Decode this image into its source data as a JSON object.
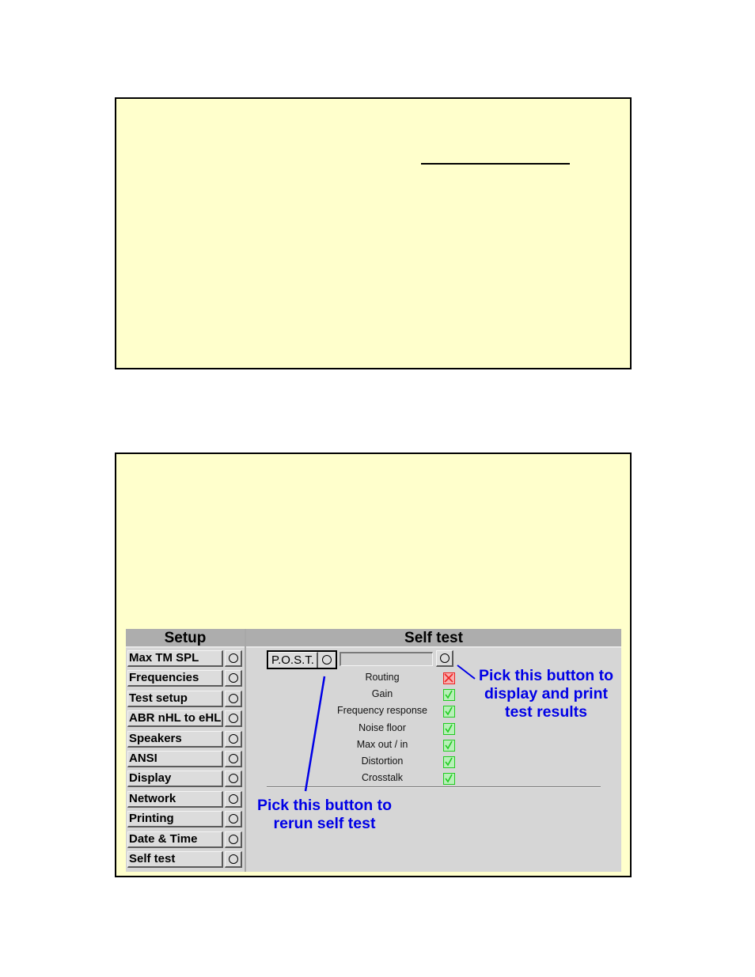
{
  "colors": {
    "slide_background": "#ffffcc",
    "panel_gray": "#d6d6d6",
    "header_gray": "#adadad",
    "annotation_blue": "#0000e6",
    "pass_green": "#22cc22",
    "fail_red": "#ee2222"
  },
  "setup": {
    "header": "Setup",
    "items": [
      {
        "label": "Max TM SPL"
      },
      {
        "label": "Frequencies"
      },
      {
        "label": "Test setup"
      },
      {
        "label": "ABR nHL to eHL"
      },
      {
        "label": "Speakers"
      },
      {
        "label": "ANSI"
      },
      {
        "label": "Display"
      },
      {
        "label": "Network"
      },
      {
        "label": "Printing"
      },
      {
        "label": "Date & Time"
      },
      {
        "label": "Self test"
      }
    ]
  },
  "self_test": {
    "header": "Self test",
    "post_button_label": "P.O.S.T.",
    "tests": [
      {
        "name": "Routing",
        "status": "fail"
      },
      {
        "name": "Gain",
        "status": "pass"
      },
      {
        "name": "Frequency response",
        "status": "pass"
      },
      {
        "name": "Noise floor",
        "status": "pass"
      },
      {
        "name": "Max out / in",
        "status": "pass"
      },
      {
        "name": "Distortion",
        "status": "pass"
      },
      {
        "name": "Crosstalk",
        "status": "pass"
      }
    ]
  },
  "annotations": {
    "results": "Pick this button to display and print test results",
    "rerun": "Pick this button to rerun self test"
  }
}
